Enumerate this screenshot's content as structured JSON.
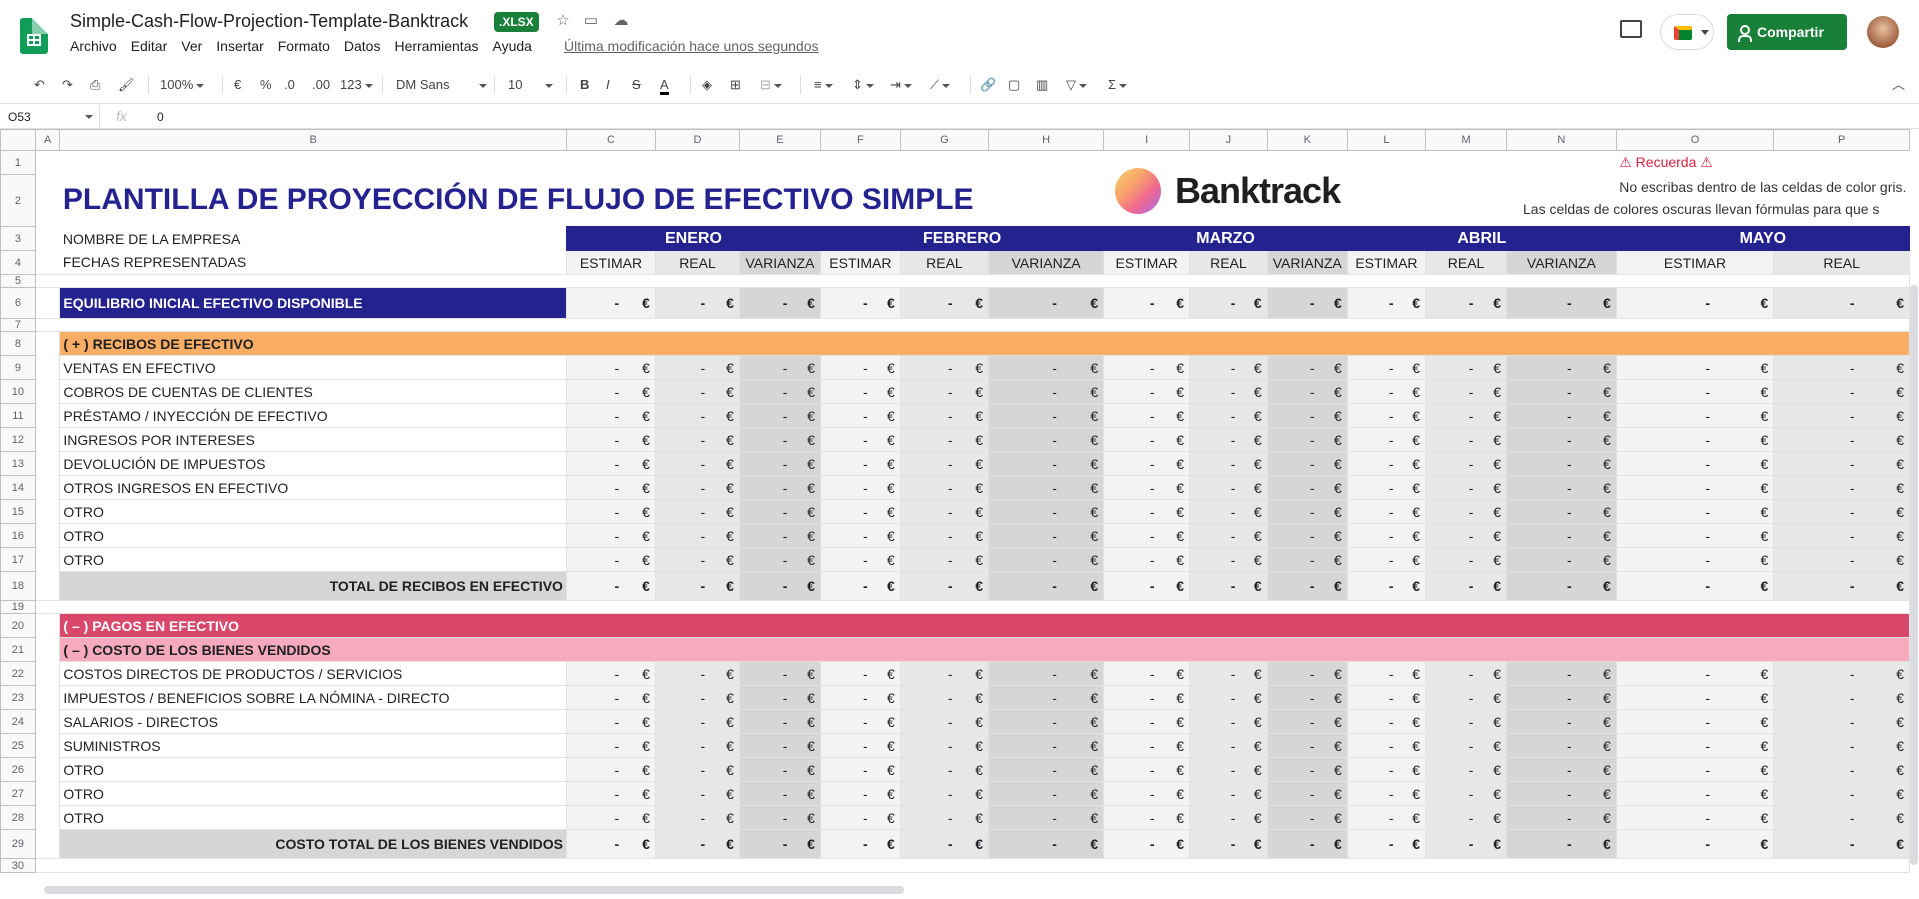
{
  "app": {
    "doc_title": "Simple-Cash-Flow-Projection-Template-Banktrack",
    "badge": ".XLSX",
    "last_modified": "Última modificación hace unos segundos",
    "share_label": "Compartir"
  },
  "menu": [
    "Archivo",
    "Editar",
    "Ver",
    "Insertar",
    "Formato",
    "Datos",
    "Herramientas",
    "Ayuda"
  ],
  "toolbar": {
    "zoom": "100%",
    "currency": "€",
    "percent": "%",
    "dec_less": ".0",
    "dec_more": ".00",
    "format": "123",
    "font": "DM Sans",
    "size": "10"
  },
  "formula": {
    "cell": "O53",
    "fx": "fx",
    "value": "0"
  },
  "columns": [
    "A",
    "B",
    "C",
    "D",
    "E",
    "F",
    "G",
    "H",
    "I",
    "J",
    "K",
    "L",
    "M",
    "N",
    "O",
    "P"
  ],
  "sheet": {
    "title": "PLANTILLA DE PROYECCIÓN DE FLUJO DE EFECTIVO SIMPLE",
    "brand": "Banktrack",
    "remind_title": "⚠ Recuerda ⚠",
    "remind_1": "No escribas dentro de las celdas de color gris.",
    "remind_2": "Las celdas de colores oscuras llevan fórmulas para que s",
    "company": "NOMBRE DE LA EMPRESA",
    "dates": "FECHAS REPRESENTADAS",
    "months": [
      "ENERO",
      "FEBRERO",
      "MARZO",
      "ABRIL",
      "MAYO"
    ],
    "sub": [
      "ESTIMAR",
      "REAL",
      "VARIANZA"
    ],
    "opening": "EQUILIBRIO INICIAL EFECTIVO DISPONIBLE",
    "receipts": "( + )  RECIBOS DE EFECTIVO",
    "receipt_items": [
      "VENTAS EN EFECTIVO",
      "COBROS DE CUENTAS DE CLIENTES",
      "PRÉSTAMO / INYECCIÓN DE EFECTIVO",
      "INGRESOS POR INTERESES",
      "DEVOLUCIÓN DE IMPUESTOS",
      "OTROS INGRESOS EN EFECTIVO",
      "OTRO",
      "OTRO",
      "OTRO"
    ],
    "receipts_total": "TOTAL DE RECIBOS EN EFECTIVO",
    "payments": "( – )  PAGOS EN EFECTIVO",
    "cogs": "( – )  COSTO DE LOS BIENES VENDIDOS",
    "cogs_items": [
      "COSTOS DIRECTOS DE PRODUCTOS / SERVICIOS",
      "IMPUESTOS / BENEFICIOS SOBRE LA NÓMINA - DIRECTO",
      "SALARIOS - DIRECTOS",
      "SUMINISTROS",
      "OTRO",
      "OTRO",
      "OTRO"
    ],
    "cogs_total": "COSTO TOTAL DE LOS BIENES VENDIDOS",
    "dash": "-",
    "euro": "€"
  }
}
